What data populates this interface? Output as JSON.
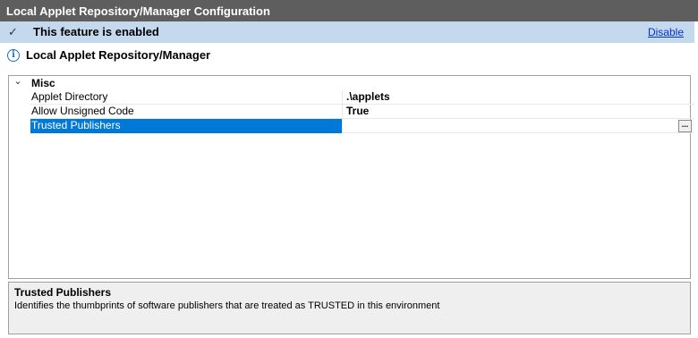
{
  "window": {
    "title": "Local Applet Repository/Manager Configuration"
  },
  "status": {
    "check_icon": "check-icon",
    "text": "This feature is enabled",
    "action_label": "Disable",
    "bar_color": "#c4d8ee"
  },
  "section": {
    "icon": "info-icon",
    "title": "Local Applet Repository/Manager"
  },
  "property_grid": {
    "category": {
      "label": "Misc",
      "icon": "chevron-down-icon",
      "expanded": true
    },
    "properties": [
      {
        "name": "Applet Directory",
        "value": ".\\applets",
        "selected": false
      },
      {
        "name": "Allow Unsigned Code",
        "value": "True",
        "selected": false
      },
      {
        "name": "Trusted Publishers",
        "value": "",
        "selected": true,
        "button_label": "..."
      }
    ],
    "selection_color": "#0078d7"
  },
  "description": {
    "title": "Trusted Publishers",
    "text": "Identifies the thumbprints of software publishers that are treated as TRUSTED in this environment"
  }
}
